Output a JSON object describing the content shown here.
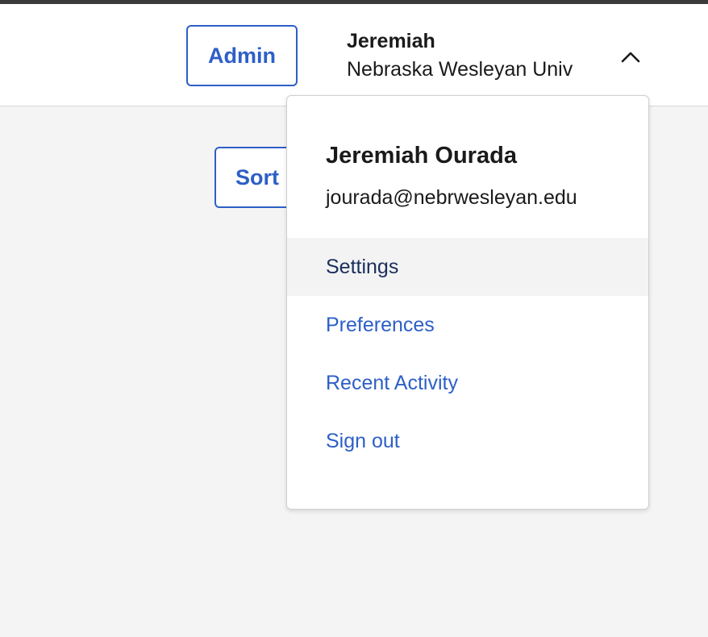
{
  "header": {
    "admin_label": "Admin",
    "user_first_name": "Jeremiah",
    "user_org": "Nebraska Wesleyan Univ",
    "menu_toggle_icon": "chevron-up-icon"
  },
  "toolbar": {
    "sort_label": "Sort"
  },
  "user_menu": {
    "full_name": "Jeremiah Ourada",
    "email": "jourada@nebrwesleyan.edu",
    "items": [
      {
        "label": "Settings",
        "active": true
      },
      {
        "label": "Preferences",
        "active": false
      },
      {
        "label": "Recent Activity",
        "active": false
      },
      {
        "label": "Sign out",
        "active": false
      }
    ]
  },
  "colors": {
    "accent": "#2d5fc7",
    "active_item_bg": "#f3f3f3",
    "active_item_text": "#1b2f5c",
    "page_bg": "#f4f4f4"
  }
}
